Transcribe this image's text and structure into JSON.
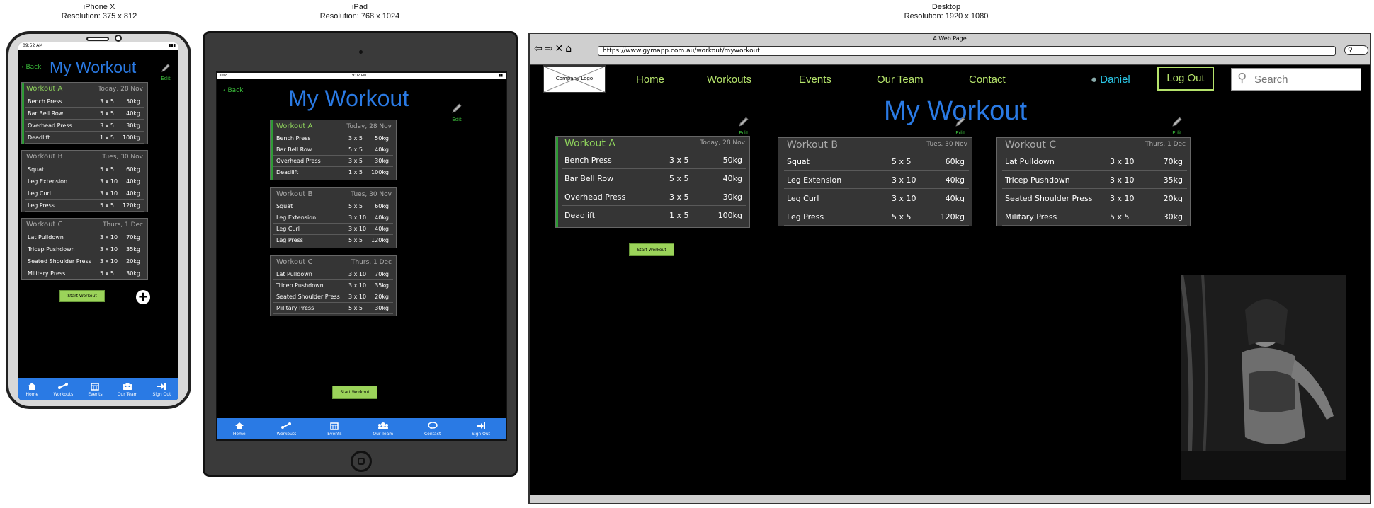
{
  "labels": {
    "phone_title": "iPhone X",
    "phone_res": "Resolution: 375 x 812",
    "tablet_title": "iPad",
    "tablet_res": "Resolution: 768 x 1024",
    "desktop_title": "Desktop",
    "desktop_res": "Resolution: 1920 x 1080"
  },
  "phone": {
    "time": "09:52 AM",
    "back": "Back",
    "title": "My Workout",
    "edit": "Edit",
    "start": "Start Workout"
  },
  "tablet": {
    "carrier": "iPad",
    "time": "9:02 PM",
    "back": "Back",
    "title": "My Workout",
    "edit": "Edit",
    "start": "Start Workout"
  },
  "tabs": {
    "home": "Home",
    "workouts": "Workouts",
    "events": "Events",
    "team": "Our Team",
    "contact": "Contact",
    "signout": "Sign Out"
  },
  "desktop": {
    "window_title": "A Web Page",
    "url": "https://www.gymapp.com.au/workout/myworkout",
    "logo": "Company Logo",
    "nav": {
      "home": "Home",
      "workouts": "Workouts",
      "events": "Events",
      "team": "Our Team",
      "contact": "Contact"
    },
    "user": "Daniel",
    "logout": "Log Out",
    "search_placeholder": "Search",
    "title": "My Workout",
    "edit": "Edit",
    "start": "Start Workout"
  },
  "workouts": [
    {
      "name": "Workout A",
      "date": "Today, 28 Nov",
      "rows": [
        {
          "exercise": "Bench Press",
          "sets": "3 x 5",
          "weight": "50kg"
        },
        {
          "exercise": "Bar Bell Row",
          "sets": "5 x 5",
          "weight": "40kg"
        },
        {
          "exercise": "Overhead Press",
          "sets": "3 x 5",
          "weight": "30kg"
        },
        {
          "exercise": "Deadlift",
          "sets": "1 x 5",
          "weight": "100kg"
        }
      ]
    },
    {
      "name": "Workout B",
      "date": "Tues, 30 Nov",
      "rows": [
        {
          "exercise": "Squat",
          "sets": "5 x 5",
          "weight": "60kg"
        },
        {
          "exercise": "Leg Extension",
          "sets": "3 x 10",
          "weight": "40kg"
        },
        {
          "exercise": "Leg Curl",
          "sets": "3 x 10",
          "weight": "40kg"
        },
        {
          "exercise": "Leg Press",
          "sets": "5 x 5",
          "weight": "120kg"
        }
      ]
    },
    {
      "name": "Workout C",
      "date": "Thurs, 1 Dec",
      "rows": [
        {
          "exercise": "Lat Pulldown",
          "sets": "3 x 10",
          "weight": "70kg"
        },
        {
          "exercise": "Tricep Pushdown",
          "sets": "3 x 10",
          "weight": "35kg"
        },
        {
          "exercise": "Seated Shoulder Press",
          "sets": "3 x 10",
          "weight": "20kg"
        },
        {
          "exercise": "Military Press",
          "sets": "5 x 5",
          "weight": "30kg"
        }
      ]
    }
  ],
  "colors": {
    "brand_blue": "#2a7ae4",
    "accent_green": "#8fd45c",
    "active_bar": "#2e9b35",
    "button_green": "#9bd35a"
  }
}
